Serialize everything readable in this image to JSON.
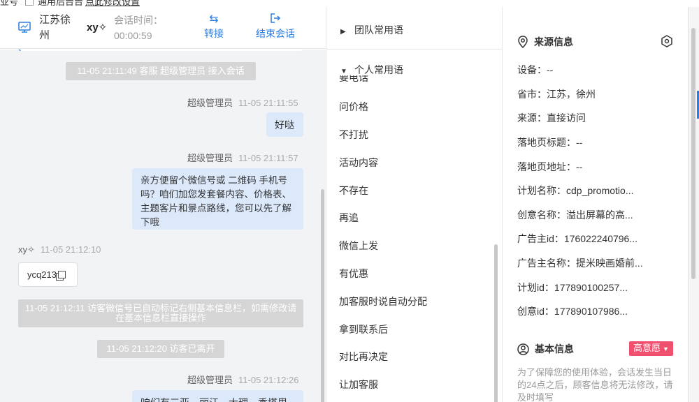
{
  "topbar": {
    "left_text": "业号",
    "checkbox_label": "通用后台台",
    "link_text": "点此修改设置"
  },
  "header": {
    "location": "江苏徐州",
    "visitor": "xy✧",
    "time_label": "会话时间：",
    "time_value": "00:00:59",
    "transfer": "转接",
    "end_session": "结束会话"
  },
  "chat": {
    "sys1": "11-05 21:11:49 客服 超级管理员 接入会话",
    "msg1": {
      "sender": "超级管理员",
      "time": "11-05 21:11:55",
      "text": "好哒"
    },
    "msg2": {
      "sender": "超级管理员",
      "time": "11-05 21:11:57",
      "text": "亲方便留个微信号或 二维码 手机号吗？咱们加您发套餐内容、价格表、主题客片和景点路线，您可以先了解下哦"
    },
    "msg3": {
      "sender": "xy✧",
      "time": "11-05 21:12:10",
      "text": "ycq213"
    },
    "sys2": "11-05 21:12:11 访客微信号已自动标记右侧基本信息栏，如需修改请在基本信息栏直接操作",
    "sys3": "11-05 21:12:20 访客已离开",
    "msg4": {
      "sender": "超级管理员",
      "time": "11-05 21:12:26",
      "text": "咱们有三亚、丽江、大理、秀塔里"
    }
  },
  "phrases": {
    "team_group": "团队常用语",
    "personal_group": "个人常用语",
    "cut_item": "要电话",
    "items": [
      "问价格",
      "不打扰",
      "活动内容",
      "不存在",
      "再追",
      "微信上发",
      "有优惠",
      "加客服时说自动分配",
      "拿到联系后",
      "对比再决定",
      "让加客服"
    ]
  },
  "info": {
    "source_title": "来源信息",
    "rows": [
      {
        "k": "设备：",
        "v": "--"
      },
      {
        "k": "省市：",
        "v": "江苏，徐州"
      },
      {
        "k": "来源：",
        "v": "直接访问"
      },
      {
        "k": "落地页标题：",
        "v": "--"
      },
      {
        "k": "落地页地址：",
        "v": "--"
      },
      {
        "k": "计划名称：",
        "v": "cdp_promotio..."
      },
      {
        "k": "创意名称：",
        "v": "溢出屏幕的高..."
      },
      {
        "k": "广告主id：",
        "v": "176022240796..."
      },
      {
        "k": "广告主名称：",
        "v": "提米映画婚前..."
      },
      {
        "k": "计划id：",
        "v": "177890100257..."
      },
      {
        "k": "创意id：",
        "v": "177890107986..."
      }
    ],
    "basic_title": "基本信息",
    "intent_badge": "高意愿",
    "note": "为了保障您的使用体验，会话发生当日的24点之后，顾客信息将无法修改，请及时填写"
  },
  "colors": {
    "accent": "#2a7de1",
    "bubble": "#dce9fb",
    "badge": "#f0506e",
    "sysmsg": "#d5d5d5"
  }
}
